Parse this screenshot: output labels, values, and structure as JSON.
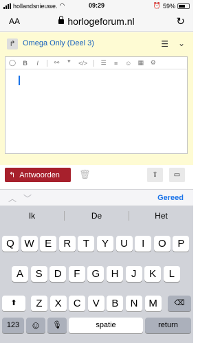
{
  "status": {
    "carrier": "hollandsnieuwe.",
    "time": "09:29",
    "battery": "59%"
  },
  "browser": {
    "text_size": "AA",
    "url": "horlogeforum.nl"
  },
  "topic": {
    "title": "Omega Only (Deel 3)"
  },
  "actions": {
    "reply_label": "Antwoorden"
  },
  "keyboard": {
    "accessory": {
      "done_label": "Gereed"
    },
    "suggestions": [
      "Ik",
      "De",
      "Het"
    ],
    "row1": [
      "Q",
      "W",
      "E",
      "R",
      "T",
      "Y",
      "U",
      "I",
      "O",
      "P"
    ],
    "row2": [
      "A",
      "S",
      "D",
      "F",
      "G",
      "H",
      "J",
      "K",
      "L"
    ],
    "row3": [
      "Z",
      "X",
      "C",
      "V",
      "B",
      "N",
      "M"
    ],
    "numbers_label": "123",
    "space_label": "spatie",
    "return_label": "return"
  },
  "colors": {
    "accent": "#1560bd",
    "reply_button": "#a7202c",
    "editor_bg": "#fefbd3"
  }
}
